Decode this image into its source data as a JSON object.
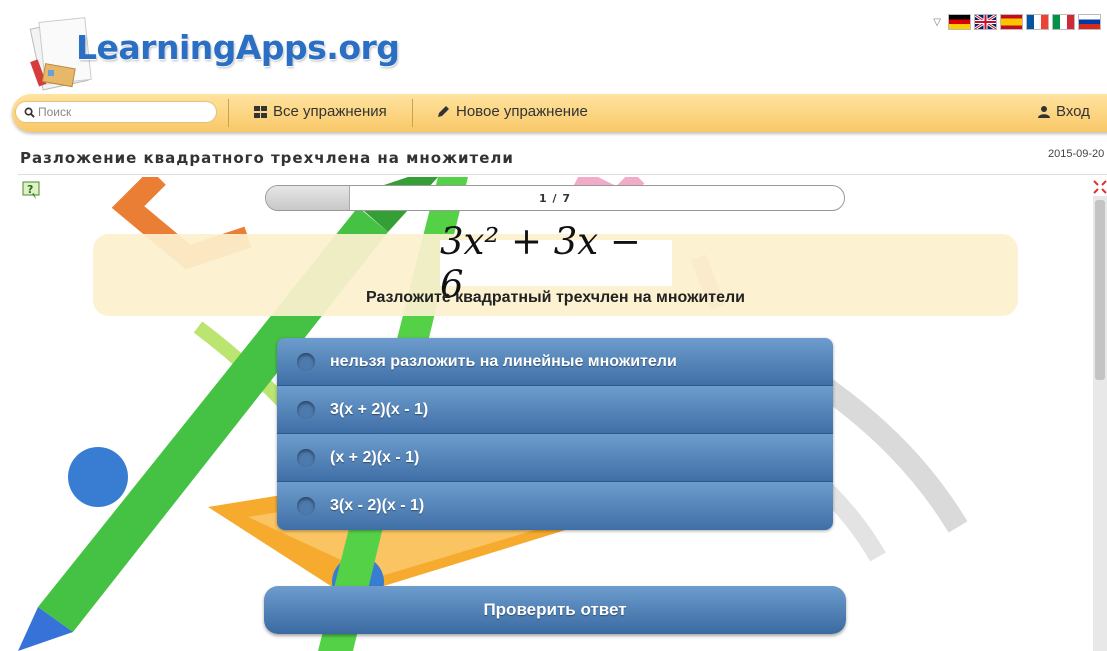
{
  "header": {
    "logo_text": "LearningApps.org",
    "languages": [
      {
        "name": "Deutsch",
        "colors": [
          "#000000",
          "#dd0000",
          "#ffce00"
        ]
      },
      {
        "name": "English",
        "colors": [
          "#012169",
          "#ffffff",
          "#c8102e"
        ]
      },
      {
        "name": "Español",
        "colors": [
          "#c60b1e",
          "#ffc400",
          "#c60b1e"
        ]
      },
      {
        "name": "Français",
        "colors": [
          "#0055a4",
          "#ffffff",
          "#ef4135"
        ]
      },
      {
        "name": "Italiano",
        "colors": [
          "#009246",
          "#ffffff",
          "#ce2b37"
        ]
      },
      {
        "name": "Русский",
        "colors": [
          "#ffffff",
          "#0039a6",
          "#d52b1e"
        ]
      }
    ]
  },
  "nav": {
    "search_placeholder": "Поиск",
    "all_exercises": "Все упражнения",
    "new_exercise": "Новое упражнение",
    "login": "Вход"
  },
  "page": {
    "title": "Разложение квадратного трехчлена на множители",
    "date": "2015-09-20"
  },
  "quiz": {
    "progress_text": "1 / 7",
    "progress_fraction": 0.143,
    "formula": "3x² + 3x − 6",
    "question": "Разложите квадратный трехчлен на множители",
    "options": [
      "нельзя разложить на линейные множители",
      "3(x + 2)(x - 1)",
      "(x + 2)(x - 1)",
      "3(x - 2)(x - 1)"
    ],
    "check_button": "Проверить ответ"
  },
  "colors": {
    "nav_bar": "#f9c867",
    "option_blue": "#4a7ab0",
    "logo_blue": "#2a6fc4"
  }
}
